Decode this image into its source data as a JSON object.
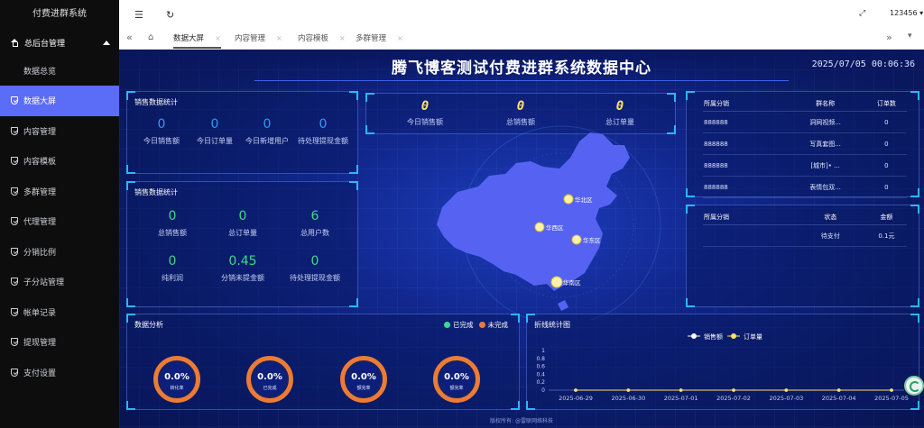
{
  "sidebar": {
    "brand": "付费进群系统",
    "group_label": "总后台管理",
    "sub_items": [
      "数据总览"
    ],
    "items": [
      {
        "label": "数据大屏",
        "active": true
      },
      {
        "label": "内容管理"
      },
      {
        "label": "内容模板"
      },
      {
        "label": "多群管理"
      },
      {
        "label": "代理管理"
      },
      {
        "label": "分销比例"
      },
      {
        "label": "子分站管理"
      },
      {
        "label": "帐单记录"
      },
      {
        "label": "提现管理"
      },
      {
        "label": "支付设置"
      }
    ]
  },
  "topbar": {
    "user": "123456"
  },
  "tabs": [
    {
      "label": "数据大屏",
      "active": true
    },
    {
      "label": "内容管理"
    },
    {
      "label": "内容模板"
    },
    {
      "label": "多群管理"
    }
  ],
  "screen": {
    "title": "腾飞博客测试付费进群系统数据中心",
    "clock": "2025/07/05 00:06:36",
    "sales_panel_1": {
      "title": "销售数据统计",
      "stats": [
        {
          "value": "0",
          "label": "今日销售额"
        },
        {
          "value": "0",
          "label": "今日订单量"
        },
        {
          "value": "0",
          "label": "今日新增用户"
        },
        {
          "value": "0",
          "label": "待处理提现金额"
        }
      ]
    },
    "sales_panel_2": {
      "title": "销售数据统计",
      "stats": [
        {
          "value": "0",
          "label": "总销售额"
        },
        {
          "value": "0",
          "label": "总订单量"
        },
        {
          "value": "6",
          "label": "总用户数"
        },
        {
          "value": "0",
          "label": "纯利润"
        },
        {
          "value": "0.45",
          "label": "分销未提金额"
        },
        {
          "value": "0",
          "label": "待处理提现金额"
        }
      ]
    },
    "center_stats": [
      {
        "value": "0",
        "label": "今日销售额"
      },
      {
        "value": "0",
        "label": "总销售额"
      },
      {
        "value": "0",
        "label": "总订单量"
      }
    ],
    "map": {
      "regions": [
        "华北区",
        "华西区",
        "华东区",
        "华南区"
      ],
      "colors": {
        "land": "#5663f2",
        "marker": "#fff3a6"
      }
    },
    "group_table": {
      "headers": [
        "所属分销",
        "群名称",
        "订单数"
      ],
      "rows": [
        [
          "888888",
          "洞网视频...",
          "0"
        ],
        [
          "888888",
          "写真套图...",
          "0"
        ],
        [
          "888888",
          "[城市]• ...",
          "0"
        ],
        [
          "888888",
          "表情包双...",
          "0"
        ]
      ]
    },
    "order_table": {
      "headers": [
        "所属分销",
        "状态",
        "金额"
      ],
      "rows": [
        [
          "",
          "待支付",
          "0.1元"
        ]
      ]
    },
    "analysis": {
      "title": "数据分析",
      "legend": [
        {
          "label": "已完成",
          "color": "#3dd98a"
        },
        {
          "label": "未完成",
          "color": "#ec7b36"
        }
      ],
      "donuts": [
        {
          "value": "0.0%",
          "label": "转化率"
        },
        {
          "value": "0.0%",
          "label": "已完成"
        },
        {
          "value": "0.0%",
          "label": "额完率"
        },
        {
          "value": "0.0%",
          "label": "额完率"
        }
      ]
    },
    "footer": "版权所有: @雷联网络科技"
  },
  "chart_data": {
    "type": "line",
    "title": "折线统计图",
    "x": [
      "2025-06-29",
      "2025-06-30",
      "2025-07-01",
      "2025-07-02",
      "2025-07-03",
      "2025-07-04",
      "2025-07-05"
    ],
    "series": [
      {
        "name": "销售额",
        "values": [
          0,
          0,
          0,
          0,
          0,
          0,
          0
        ],
        "color": "#ffffff"
      },
      {
        "name": "订单量",
        "values": [
          0,
          0,
          0,
          0,
          0,
          0,
          0
        ],
        "color": "#ffe26a"
      }
    ],
    "yticks": [
      "0",
      "0.2",
      "0.4",
      "0.6",
      "0.8",
      "1"
    ],
    "ylim": [
      0,
      1
    ],
    "legend": "top-center",
    "grid": false
  }
}
